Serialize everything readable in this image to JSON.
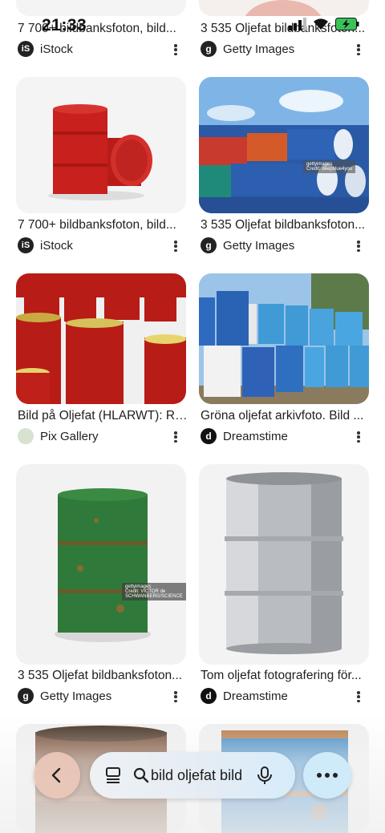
{
  "status": {
    "time": "21:33"
  },
  "results": [
    {
      "caption": "7 700+ bildbanksfoton, bild...",
      "source": "iStock",
      "logo": "iStock"
    },
    {
      "caption": "3 535 Oljefat bildbanksfoton...",
      "source": "Getty Images",
      "logo": "getty"
    },
    {
      "caption": "7 700+ bildbanksfoton, bild...",
      "source": "iStock",
      "logo": "iStock"
    },
    {
      "caption": "3 535 Oljefat bildbanksfoton...",
      "source": "Getty Images",
      "logo": "getty"
    },
    {
      "caption": "Bild på Oljefat (HLARWT): Ri...",
      "source": "Pix Gallery",
      "logo": "pix"
    },
    {
      "caption": "Gröna oljefat arkivfoto. Bild ...",
      "source": "Dreamstime",
      "logo": "dreamstime"
    },
    {
      "caption": "3 535 Oljefat bildbanksfoton...",
      "source": "Getty Images",
      "logo": "getty"
    },
    {
      "caption": "Tom oljefat fotografering för...",
      "source": "Dreamstime",
      "logo": "dreamstime"
    }
  ],
  "watermarks": {
    "getty_blue": "gettyimages\nCredit: deepblue4you",
    "getty_green": "gettyimages\nCredit: VICTOR de SCHWANBERG/SCIENCE"
  },
  "bottom_bar": {
    "query": "bild oljefat bild",
    "back_icon": "chevron-left-icon",
    "tabs_icon": "tabs-icon",
    "search_icon": "search-icon",
    "mic_icon": "mic-icon",
    "more_icon": "more-horizontal-icon"
  },
  "colors": {
    "red_drum": "#c8201c",
    "blue_drum": "#2d5fb0",
    "green_drum": "#2f7a3a",
    "silver_drum": "#b9bcc0",
    "more_button_bg": "#cfeaf9",
    "back_button_bg": "#ebc8b9"
  }
}
